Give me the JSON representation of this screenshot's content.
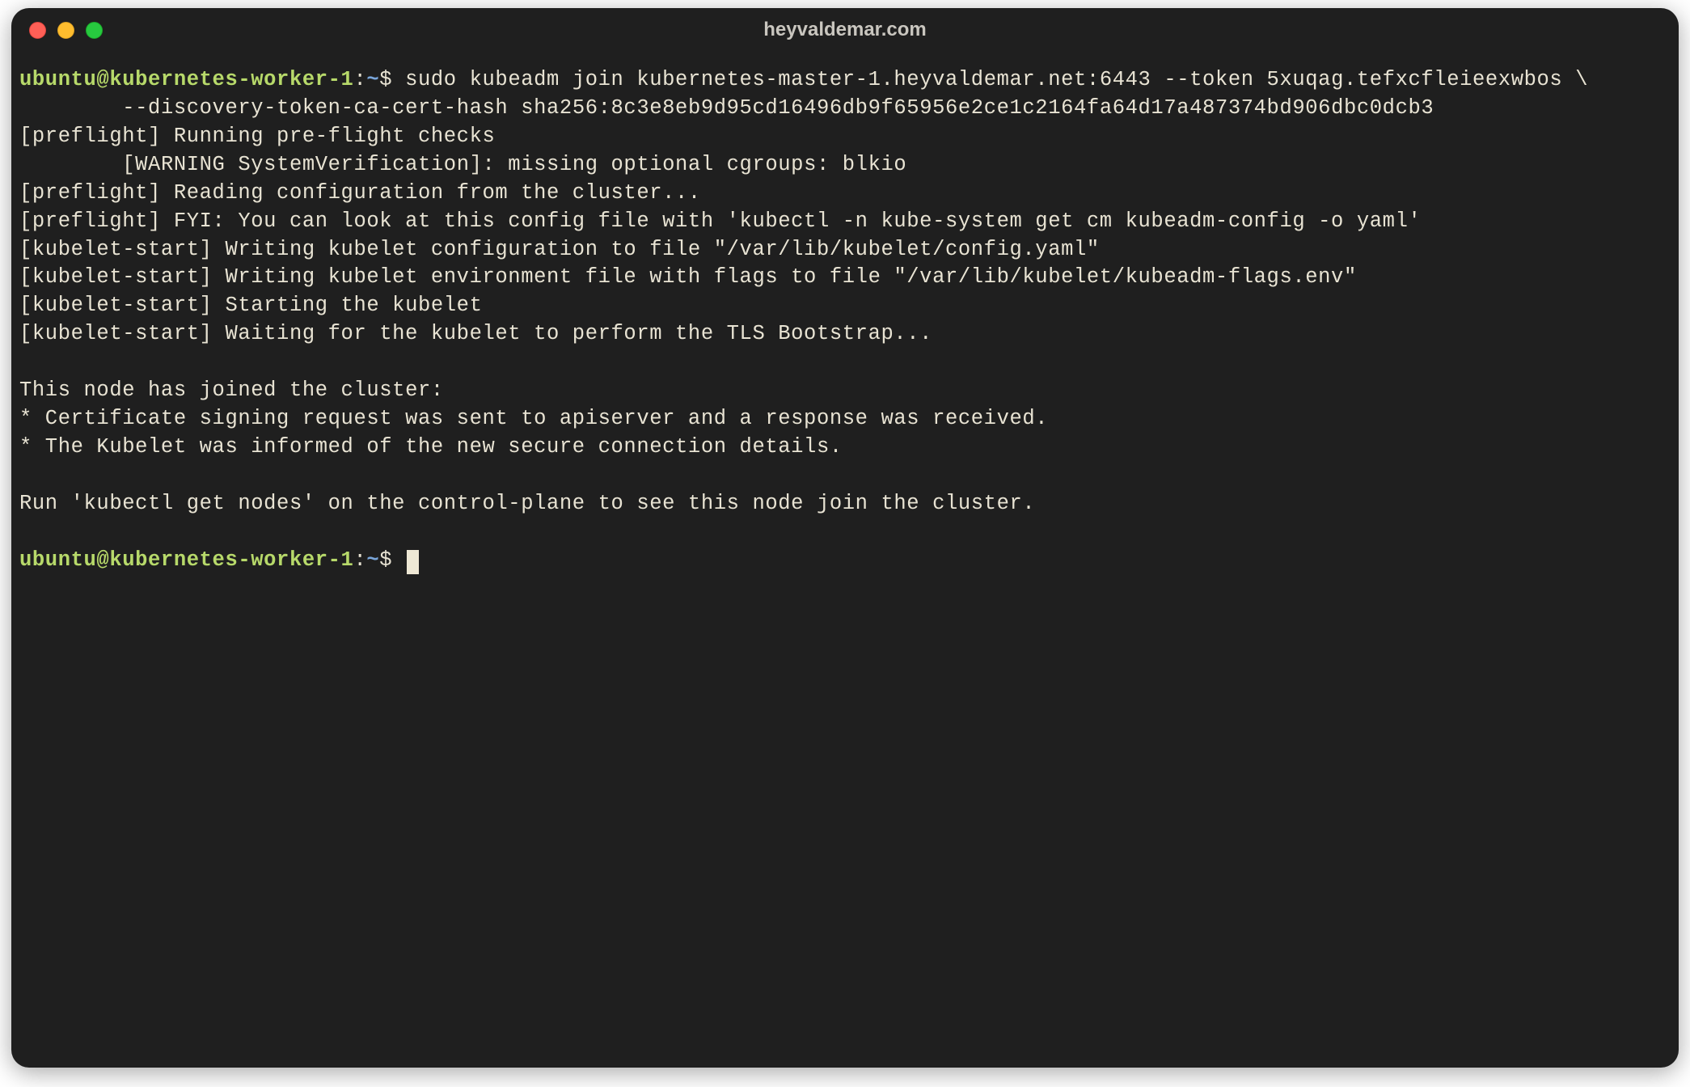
{
  "window": {
    "title": "heyvaldemar.com"
  },
  "prompt": {
    "user_host": "ubuntu@kubernetes-worker-1",
    "sep": ":",
    "path": "~",
    "symbol": "$"
  },
  "command": {
    "line1": "sudo kubeadm join kubernetes-master-1.heyvaldemar.net:6443 --token 5xuqag.tefxcfleieexwbos \\",
    "line2": "        --discovery-token-ca-cert-hash sha256:8c3e8eb9d95cd16496db9f65956e2ce1c2164fa64d17a487374bd906dbc0dcb3"
  },
  "output_lines": [
    "[preflight] Running pre-flight checks",
    "        [WARNING SystemVerification]: missing optional cgroups: blkio",
    "[preflight] Reading configuration from the cluster...",
    "[preflight] FYI: You can look at this config file with 'kubectl -n kube-system get cm kubeadm-config -o yaml'",
    "[kubelet-start] Writing kubelet configuration to file \"/var/lib/kubelet/config.yaml\"",
    "[kubelet-start] Writing kubelet environment file with flags to file \"/var/lib/kubelet/kubeadm-flags.env\"",
    "[kubelet-start] Starting the kubelet",
    "[kubelet-start] Waiting for the kubelet to perform the TLS Bootstrap...",
    "",
    "This node has joined the cluster:",
    "* Certificate signing request was sent to apiserver and a response was received.",
    "* The Kubelet was informed of the new secure connection details.",
    "",
    "Run 'kubectl get nodes' on the control-plane to see this node join the cluster.",
    ""
  ]
}
